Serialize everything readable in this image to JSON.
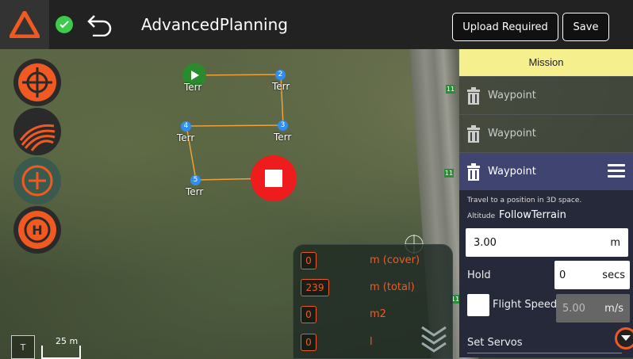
{
  "app": {
    "title": "AdvancedPlanning",
    "connected_icon": "check-circle-icon"
  },
  "toolbar": {
    "upload_label": "Upload Required",
    "save_label": "Save"
  },
  "tools": [
    "crosshair-icon",
    "survey-icon",
    "add-icon",
    "rtl-icon"
  ],
  "map": {
    "waypoints": [
      {
        "num": "2",
        "label": "Terr"
      },
      {
        "num": "3",
        "label": "Terr"
      },
      {
        "num": "4",
        "label": "Terr"
      },
      {
        "num": "5",
        "label": "Terr"
      }
    ],
    "start_label": "Terr",
    "road_signs": [
      "11",
      "11",
      "11"
    ],
    "scale": {
      "toggle": "T",
      "text": "25 m"
    }
  },
  "stats": [
    {
      "value": "0",
      "unit": "m (cover)"
    },
    {
      "value": "239",
      "unit": "m (total)"
    },
    {
      "value": "0",
      "unit": "m2"
    },
    {
      "value": "0",
      "unit": "l"
    }
  ],
  "mission": {
    "header": "Mission",
    "items": [
      "Waypoint",
      "Waypoint",
      "Waypoint"
    ],
    "detail": {
      "description": "Travel to a position in 3D space.",
      "altitude_label": "Altitude",
      "altitude_mode": "FollowTerrain",
      "altitude_value": "3.00",
      "altitude_unit": "m",
      "hold_label": "Hold",
      "hold_value": "0",
      "hold_unit": "secs",
      "flight_speed_label": "Flight Speed",
      "flight_speed_value": "5.00",
      "flight_speed_unit": "m/s",
      "servos_label": "Set Servos"
    }
  },
  "colors": {
    "accent": "#f05a22",
    "mission_header": "#f5ef8e",
    "active_item": "#3f4570"
  }
}
